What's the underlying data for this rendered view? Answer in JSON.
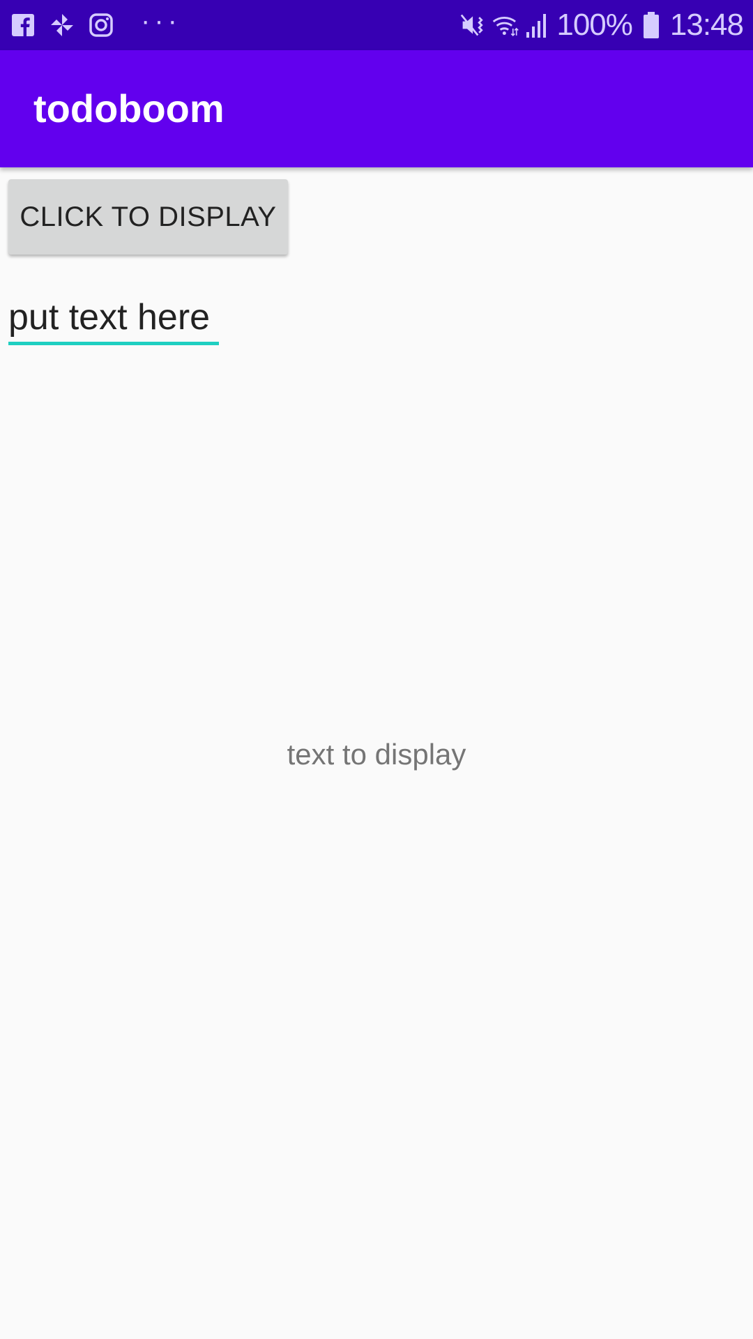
{
  "status_bar": {
    "left_icons": [
      "facebook-icon",
      "pinwheel-icon",
      "instagram-icon"
    ],
    "overflow": "···",
    "right_icons": [
      "mute-vibrate-icon",
      "wifi-icon",
      "signal-icon"
    ],
    "battery_percent": "100%",
    "battery_icon": "battery-icon",
    "time": "13:48"
  },
  "app_bar": {
    "title": "todoboom"
  },
  "main": {
    "button_label": "CLICK TO DISPLAY",
    "input_placeholder": "put text here",
    "input_value": "",
    "display_text": "text to display"
  },
  "colors": {
    "status_bar": "#3700b3",
    "app_bar": "#6200ee",
    "input_underline": "#1fcfc1",
    "background": "#fafafa",
    "button": "#d6d7d7"
  }
}
